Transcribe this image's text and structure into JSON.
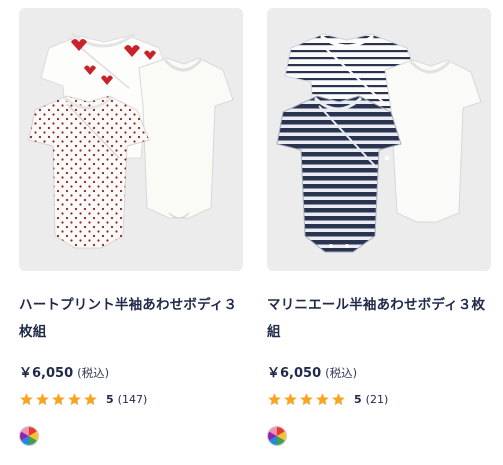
{
  "products": [
    {
      "title": "ハートプリント半袖あわせボディ３枚組",
      "price": "￥6,050",
      "tax_label": "(税込)",
      "rating_value": "5",
      "rating_count": "(147)",
      "stars": 5,
      "image_icon": "heart-print-bodysuits-image",
      "swatch_icon": "multicolor-swatch-icon"
    },
    {
      "title": "マリニエール半袖あわせボディ３枚組",
      "price": "￥6,050",
      "tax_label": "(税込)",
      "rating_value": "5",
      "rating_count": "(21)",
      "stars": 5,
      "image_icon": "striped-bodysuits-image",
      "swatch_icon": "multicolor-swatch-icon"
    }
  ],
  "colors": {
    "star": "#f5a623",
    "text": "#1f2a4a",
    "image_bg": "#ececed",
    "navy": "#2a3350",
    "heart_red": "#c8222b"
  }
}
